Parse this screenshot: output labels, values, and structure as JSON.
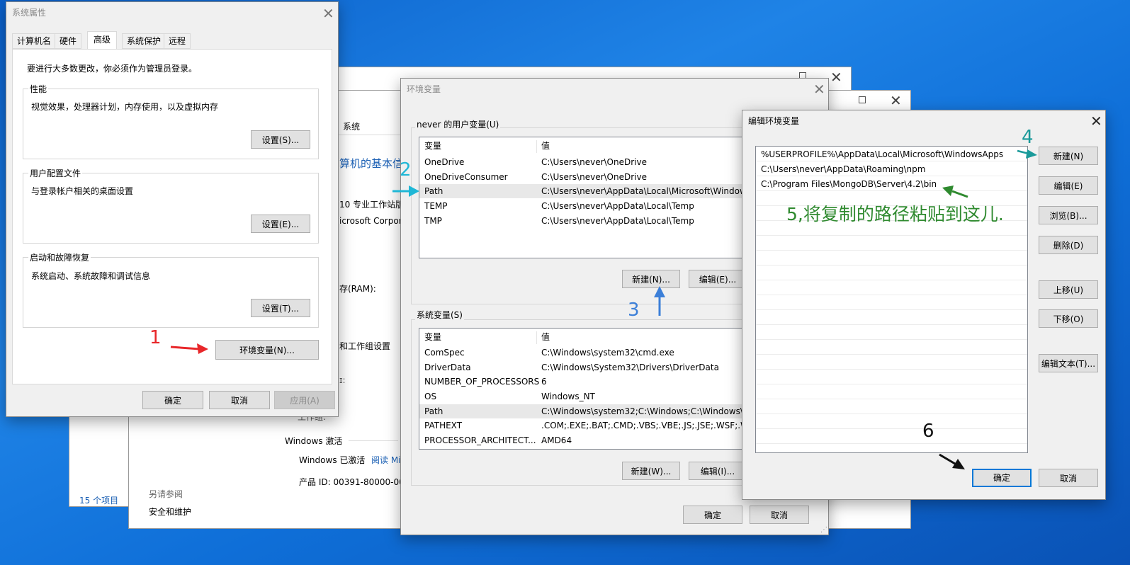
{
  "sys_props": {
    "title": "系统属性",
    "tabs": [
      "计算机名",
      "硬件",
      "高级",
      "系统保护",
      "远程"
    ],
    "admin_note": "要进行大多数更改，你必须作为管理员登录。",
    "performance": {
      "label": "性能",
      "desc": "视觉效果，处理器计划，内存使用，以及虚拟内存",
      "button": "设置(S)..."
    },
    "profiles": {
      "label": "用户配置文件",
      "desc": "与登录帐户相关的桌面设置",
      "button": "设置(E)..."
    },
    "startup": {
      "label": "启动和故障恢复",
      "desc": "系统启动、系统故障和调试信息",
      "button": "设置(T)..."
    },
    "env_button": "环境变量(N)...",
    "ok": "确定",
    "cancel": "取消",
    "apply": "应用(A)"
  },
  "background_window": {
    "crumb": "系统",
    "heading": "算机的基本信",
    "edition": "10 专业工作站版",
    "corp": "icrosoft Corpor",
    "ram": "存(RAM):",
    "workgroup": "和工作组设置",
    "activation_label": "Windows 激活",
    "activated": "Windows 已激活",
    "read_link": "阅读 Mi",
    "product_id": "产品 ID: 00391-80000-000",
    "see_also": "另请参阅",
    "security": "安全和维护",
    "items_count": "15 个项目",
    "frag1": "ɪ:",
    "frag2": "工作组:"
  },
  "env_vars": {
    "title": "环境变量",
    "user_label": "never 的用户变量(U)",
    "col_var": "变量",
    "col_val": "值",
    "user_rows": [
      {
        "name": "OneDrive",
        "value": "C:\\Users\\never\\OneDrive"
      },
      {
        "name": "OneDriveConsumer",
        "value": "C:\\Users\\never\\OneDrive"
      },
      {
        "name": "Path",
        "value": "C:\\Users\\never\\AppData\\Local\\Microsoft\\Window"
      },
      {
        "name": "TEMP",
        "value": "C:\\Users\\never\\AppData\\Local\\Temp"
      },
      {
        "name": "TMP",
        "value": "C:\\Users\\never\\AppData\\Local\\Temp"
      }
    ],
    "user_new": "新建(N)...",
    "user_edit": "编辑(E)...",
    "sys_label": "系统变量(S)",
    "sys_rows": [
      {
        "name": "ComSpec",
        "value": "C:\\Windows\\system32\\cmd.exe"
      },
      {
        "name": "DriverData",
        "value": "C:\\Windows\\System32\\Drivers\\DriverData"
      },
      {
        "name": "NUMBER_OF_PROCESSORS",
        "value": "6"
      },
      {
        "name": "OS",
        "value": "Windows_NT"
      },
      {
        "name": "Path",
        "value": "C:\\Windows\\system32;C:\\Windows;C:\\Windows\\Sy"
      },
      {
        "name": "PATHEXT",
        "value": ".COM;.EXE;.BAT;.CMD;.VBS;.VBE;.JS;.JSE;.WSF;.WSH"
      },
      {
        "name": "PROCESSOR_ARCHITECT...",
        "value": "AMD64"
      }
    ],
    "sys_new": "新建(W)...",
    "sys_edit": "编辑(I)...",
    "ok": "确定",
    "cancel": "取消"
  },
  "edit_env": {
    "title": "编辑环境变量",
    "entries": [
      "%USERPROFILE%\\AppData\\Local\\Microsoft\\WindowsApps",
      "C:\\Users\\never\\AppData\\Roaming\\npm",
      "C:\\Program Files\\MongoDB\\Server\\4.2\\bin"
    ],
    "buttons": {
      "new": "新建(N)",
      "edit": "编辑(E)",
      "browse": "浏览(B)...",
      "delete": "删除(D)",
      "up": "上移(U)",
      "down": "下移(O)",
      "edit_text": "编辑文本(T)..."
    },
    "ok": "确定",
    "cancel": "取消"
  },
  "annotations": {
    "step1": "1",
    "step2": "2",
    "step3": "3",
    "step4": "4",
    "step5": "5,将复制的路径粘贴到这儿.",
    "step6": "6",
    "colors": {
      "red": "#e8272a",
      "cyan": "#1fb7d6",
      "blue": "#3c7fd8",
      "teal": "#1a9a9a",
      "green": "#2f8a2f",
      "black": "#111111"
    }
  }
}
